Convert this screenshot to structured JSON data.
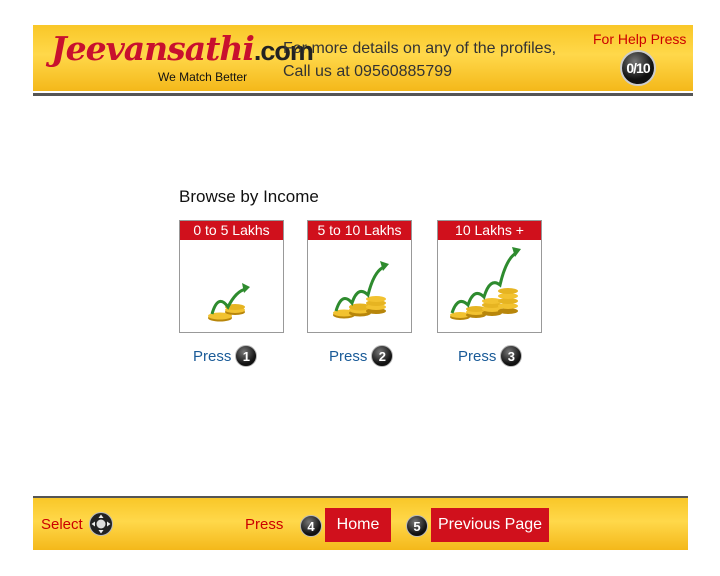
{
  "header": {
    "logo_main": "Jeevansathi",
    "logo_suffix": ".com",
    "tagline": "We Match Better",
    "contact_line1": "For more details on any of the profiles,",
    "contact_line2": "Call us at 09560885799",
    "help_label": "For Help Press",
    "help_count": "0/10"
  },
  "browse": {
    "title": "Browse by Income",
    "cards": [
      {
        "label": "0 to 5 Lakhs",
        "press": "Press",
        "key": "1"
      },
      {
        "label": "5 to 10 Lakhs",
        "press": "Press",
        "key": "2"
      },
      {
        "label": "10 Lakhs +",
        "press": "Press",
        "key": "3"
      }
    ]
  },
  "footer": {
    "select_label": "Select",
    "press_label": "Press",
    "home_key": "4",
    "home_label": "Home",
    "prev_key": "5",
    "prev_label": "Previous Page"
  },
  "colors": {
    "brand_red": "#d0101c",
    "header_gold": "#ffd84a",
    "link_blue": "#1a5b98"
  },
  "icons": [
    "coins-growth-arrow-icon",
    "remote-dpad-icon",
    "number-key-icon"
  ]
}
